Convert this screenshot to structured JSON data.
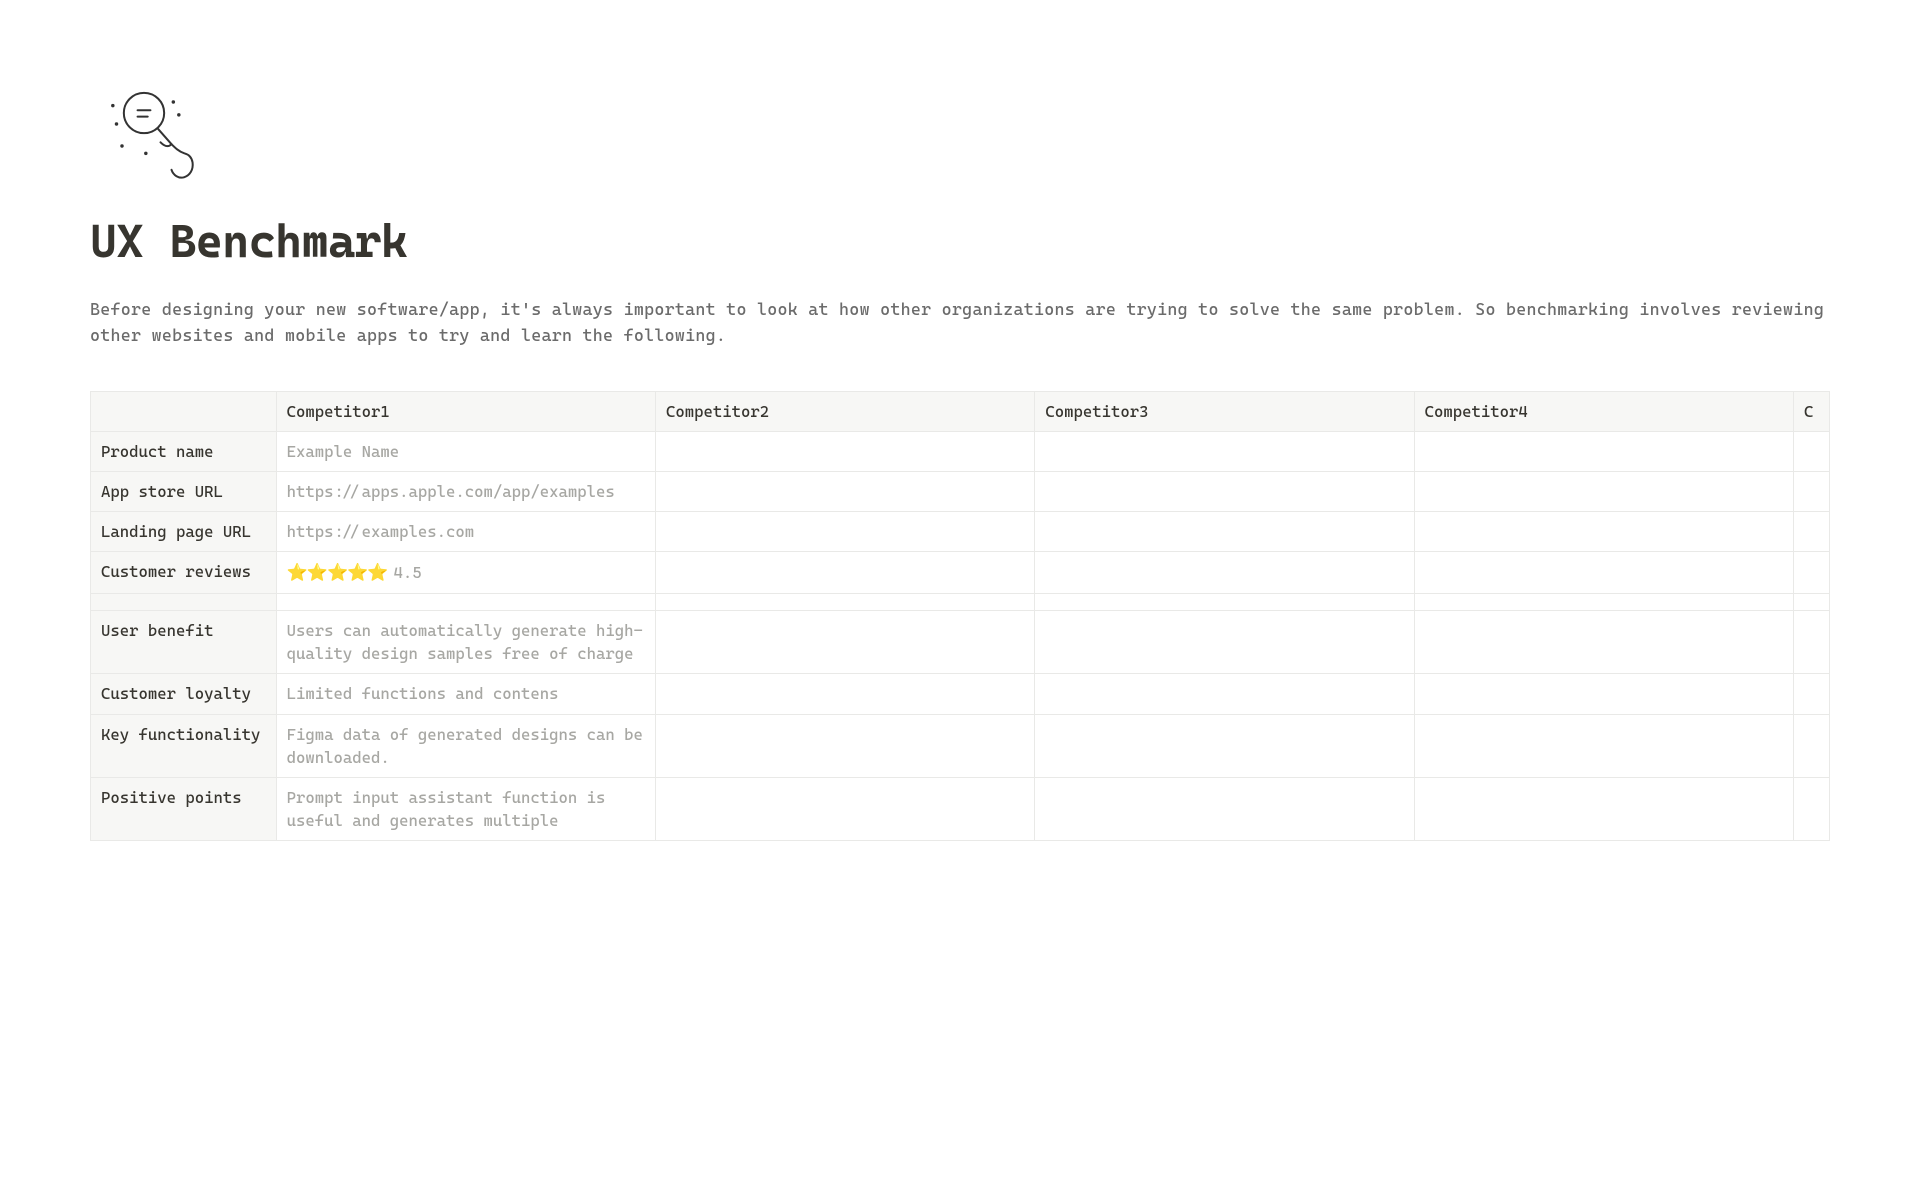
{
  "page": {
    "title": "UX Benchmark",
    "intro": "Before designing your new software/app, it's always important to look at how other organizations are trying to solve the same problem. So benchmarking involves reviewing other websites and mobile apps to try and learn the following."
  },
  "table": {
    "columns": [
      "Competitor1",
      "Competitor2",
      "Competitor3",
      "Competitor4",
      "C"
    ],
    "rows": [
      {
        "label": "Product name",
        "cells": [
          "Example Name",
          "",
          "",
          "",
          ""
        ]
      },
      {
        "label": "App store URL",
        "cells": [
          "https://apps.apple.com/app/examples",
          "",
          "",
          "",
          ""
        ]
      },
      {
        "label": "Landing page URL",
        "cells": [
          "https://examples.com",
          "",
          "",
          "",
          ""
        ]
      },
      {
        "label": "Customer reviews",
        "cells": [
          "⭐⭐⭐⭐⭐ 4.5",
          "",
          "",
          "",
          ""
        ],
        "rating": {
          "stars": "⭐⭐⭐⭐⭐",
          "value": "4.5"
        }
      },
      {
        "label": "",
        "cells": [
          "",
          "",
          "",
          "",
          ""
        ]
      },
      {
        "label": "User benefit",
        "cells": [
          "Users can automatically generate high-quality design samples free of charge",
          "",
          "",
          "",
          ""
        ]
      },
      {
        "label": "Customer loyalty",
        "cells": [
          "Limited functions and contens",
          "",
          "",
          "",
          ""
        ]
      },
      {
        "label": "Key functionality",
        "cells": [
          "Figma data of generated designs can be downloaded.",
          "",
          "",
          "",
          ""
        ]
      },
      {
        "label": "Positive points",
        "cells": [
          "Prompt input assistant function is useful and generates multiple",
          "",
          "",
          "",
          ""
        ]
      }
    ]
  }
}
